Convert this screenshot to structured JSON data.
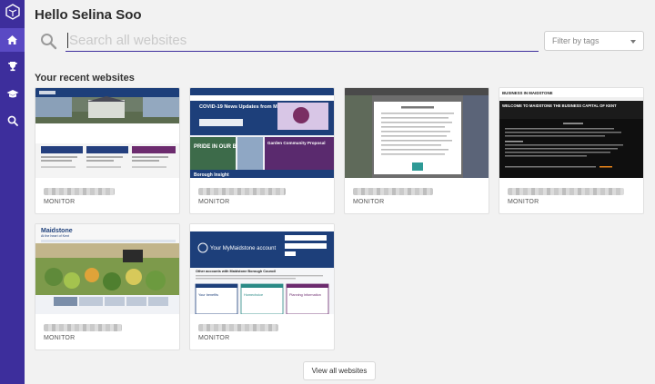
{
  "user": {
    "greeting": "Hello Selina Soo"
  },
  "search": {
    "placeholder": "Search all websites"
  },
  "filter": {
    "placeholder": "Filter by tags"
  },
  "recent": {
    "title": "Your recent websites",
    "cards": [
      {
        "label": "MONITOR",
        "thumb": "maidstone-gov-homepage"
      },
      {
        "label": "MONITOR",
        "thumb": "covid-news-homepage"
      },
      {
        "label": "MONITOR",
        "thumb": "cookie-dialog-overlay"
      },
      {
        "label": "MONITOR",
        "thumb": "business-in-maidstone"
      },
      {
        "label": "MONITOR",
        "thumb": "maidstone-market-homepage"
      },
      {
        "label": "MONITOR",
        "thumb": "my-maidstone-account"
      }
    ]
  },
  "thumbnails": {
    "covid_heading": "COVID-19 News Updates from MBC",
    "pride_text": "PRIDE IN OUR BOROUGH",
    "garden_text": "Garden Community Proposal",
    "borough_insight": "Borough Insight",
    "business_banner": "BUSINESS IN MAIDSTONE",
    "business_heading": "WELCOME TO MAIDSTONE THE BUSINESS CAPITAL OF KENT",
    "maidstone_logo": "Maidstone",
    "maidstone_tagline": "At the heart of Kent",
    "account_title": "Your MyMaidstone account",
    "account_other": "Other accounts with Maidstone Borough Council",
    "account_tile_1": "Your benefits",
    "account_tile_2": "Homechoice",
    "account_tile_3": "Planning Information"
  },
  "actions": {
    "view_all": "View all websites"
  },
  "colors": {
    "rail": "#3d2e9c",
    "rail_active": "#5a4ac4",
    "accent": "#3d2e9c"
  },
  "icons": [
    "logo-icon",
    "home-icon",
    "trophy-icon",
    "graduation-cap-icon",
    "search-icon"
  ]
}
